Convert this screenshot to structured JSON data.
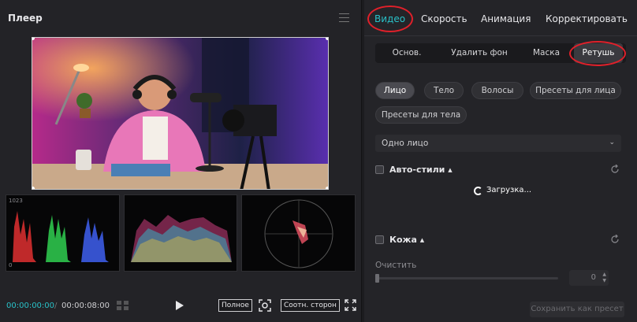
{
  "player": {
    "title": "Плеер",
    "scope_top": "1023",
    "scope_bottom": "0",
    "time_current": "00:00:00:00",
    "time_sep": "/",
    "time_total": "00:00:08:00",
    "btn_full": "Полное",
    "btn_aspect": "Соотн. сторон"
  },
  "panel": {
    "tabs": [
      "Видео",
      "Скорость",
      "Анимация",
      "Корректировать"
    ],
    "subtabs": [
      "Основ.",
      "Удалить фон",
      "Маска",
      "Ретушь"
    ],
    "chips_row1": [
      "Лицо",
      "Тело",
      "Волосы",
      "Пресеты для лица"
    ],
    "chips_row2": [
      "Пресеты для тела"
    ],
    "select_value": "Одно лицо",
    "auto_styles": "Авто-стили",
    "loading": "Загрузка...",
    "skin": "Кожа",
    "clear": "Очистить",
    "clear_value": "0",
    "save_preset": "Сохранить как пресет"
  },
  "colors": {
    "accent": "#29c1c8",
    "highlight_circle": "#e0202a"
  }
}
